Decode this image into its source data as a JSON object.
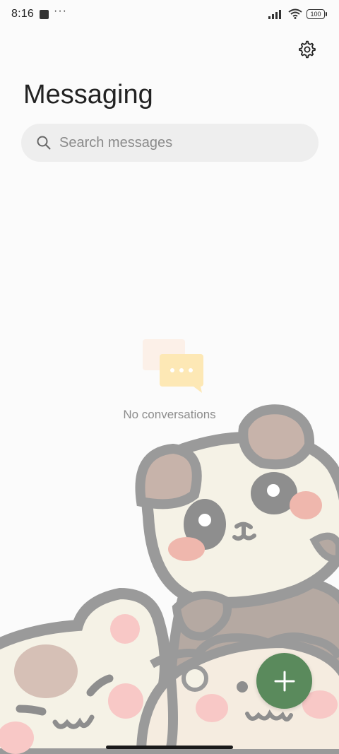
{
  "status_bar": {
    "time": "8:16",
    "more": "···",
    "battery": "100"
  },
  "header": {
    "title": "Messaging",
    "settings_icon": "gear-icon"
  },
  "search": {
    "placeholder": "Search messages",
    "icon": "search-icon"
  },
  "empty_state": {
    "text": "No conversations",
    "icon": "chat-bubbles-icon"
  },
  "fab": {
    "icon": "plus-icon",
    "color": "#5a8a5c"
  },
  "colors": {
    "background": "#fbfbfb",
    "search_bg": "#eeeeee",
    "accent": "#5a8a5c",
    "bubble": "#fde8b5"
  }
}
